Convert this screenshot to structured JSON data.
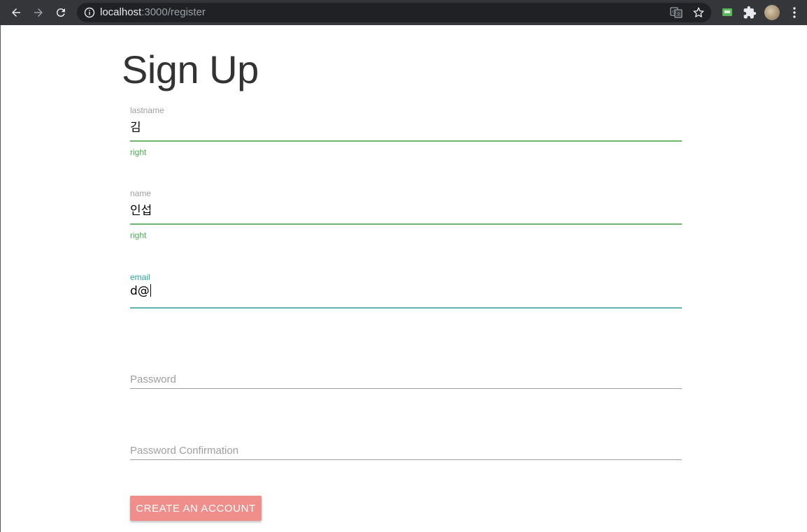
{
  "browser": {
    "url_host": "localhost",
    "url_path": ":3000/register",
    "icons": [
      "back-icon",
      "forward-icon",
      "reload-icon",
      "info-icon",
      "translate-icon",
      "star-icon",
      "extension-screen-icon",
      "puzzle-icon",
      "menu-icon"
    ]
  },
  "form": {
    "title": "Sign Up",
    "lastname": {
      "label": "lastname",
      "value": "김",
      "helper": "right"
    },
    "name": {
      "label": "name",
      "value": "인섭",
      "helper": "right"
    },
    "email": {
      "label": "email",
      "value": "d@"
    },
    "password": {
      "placeholder": "Password"
    },
    "password_confirmation": {
      "placeholder": "Password Confirmation"
    },
    "submit_label": "CREATE AN ACCOUNT"
  },
  "colors": {
    "valid": "#4caf50",
    "focus": "#26a69a",
    "button": "#ef8e8a"
  }
}
